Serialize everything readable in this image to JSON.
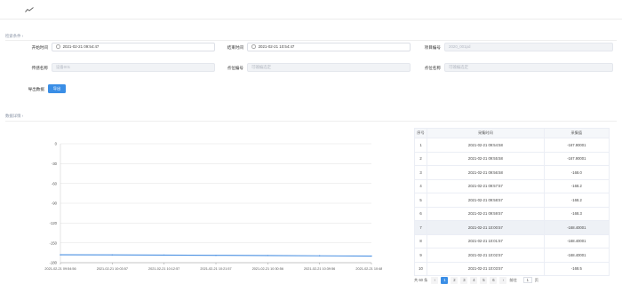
{
  "sections": {
    "condition_title": "检索条件 ›",
    "data_title": "数据详情 ›"
  },
  "form": {
    "start_time_label": "开始时间",
    "start_time_value": "2021-02-21 09:54:47",
    "end_time_label": "结束时间",
    "end_time_value": "2021-02-21 10:54:47",
    "project_code_label": "项目编号",
    "project_code_value": "2020_001pd",
    "sensor_name_label": "传感名称",
    "sensor_name_value": "设备001",
    "point_code_label": "点位编号",
    "point_code_placeholder": "可输编选定",
    "point_name_label": "点位名称",
    "point_name_placeholder": "可输编选定",
    "export_label": "导出数据",
    "export_button": "导出"
  },
  "chart_data": {
    "type": "line",
    "x": [
      "2021-02-21 09:54:56",
      "2021-02-21 10:03:57",
      "2021-02-21 10:12:57",
      "2021-02-21 10:21:57",
      "2021-02-21 10:30:56",
      "2021-02-21 10:39:56",
      "2021-02-21 10:48:59"
    ],
    "series": [
      {
        "values": [
          -168.0,
          -168.2,
          -168.5,
          -168.8,
          -169.2,
          -169.6,
          -170.0
        ]
      }
    ],
    "yticks": [
      0,
      -30,
      -60,
      -90,
      -120,
      -150,
      -180
    ],
    "ylim": [
      -180,
      0
    ],
    "grid": true,
    "color": "#4a90e2"
  },
  "table": {
    "headers": [
      "序号",
      "采集时间",
      "采集值"
    ],
    "rows": [
      {
        "idx": "1",
        "time": "2021-02-21 09:54:58",
        "value": "-167.90001"
      },
      {
        "idx": "2",
        "time": "2021-02-21 09:55:58",
        "value": "-167.90001"
      },
      {
        "idx": "3",
        "time": "2021-02-21 09:56:58",
        "value": "-168.0"
      },
      {
        "idx": "4",
        "time": "2021-02-21 09:57:57",
        "value": "-168.2"
      },
      {
        "idx": "5",
        "time": "2021-02-21 09:58:57",
        "value": "-168.2"
      },
      {
        "idx": "6",
        "time": "2021-02-21 09:59:57",
        "value": "-168.3"
      },
      {
        "idx": "7",
        "time": "2021-02-21 10:00:57",
        "value": "-168.40001"
      },
      {
        "idx": "8",
        "time": "2021-02-21 10:01:57",
        "value": "-168.40001"
      },
      {
        "idx": "9",
        "time": "2021-02-21 10:02:57",
        "value": "-168.40001"
      },
      {
        "idx": "10",
        "time": "2021-02-21 10:03:57",
        "value": "-168.5"
      }
    ],
    "highlight_row": 7
  },
  "pager": {
    "total": "共 60 条",
    "prev": "‹",
    "pages": [
      "1",
      "2",
      "3",
      "4",
      "5",
      "6"
    ],
    "active_page": "1",
    "next": "›",
    "goto_label": "前往",
    "goto_value": "1",
    "page_unit": "页"
  }
}
